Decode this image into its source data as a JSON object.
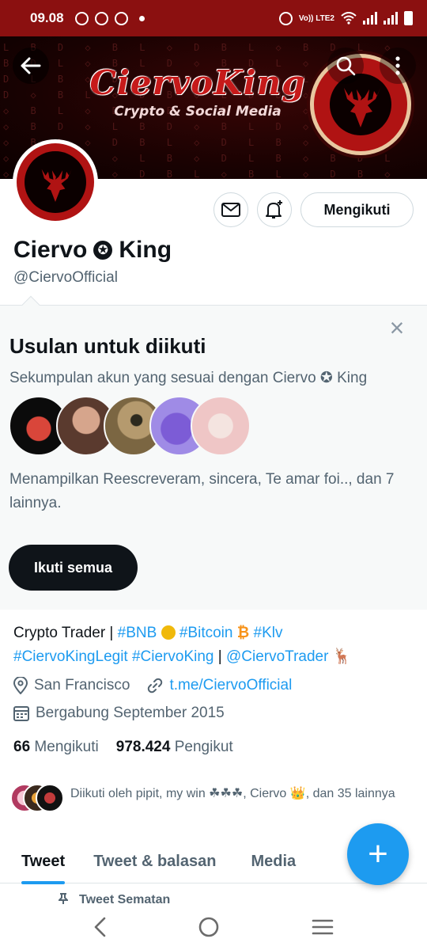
{
  "status_bar": {
    "time": "09.08",
    "net_label": "Vo)) LTE2"
  },
  "banner": {
    "title": "CiervoKing",
    "subtitle": "Crypto & Social Media",
    "pattern": "L B D ◇ B L ◇ D B L ◇ B D L ◇ B D L ◇ B L D ◇ B D L ◇ L B ◇ D L B ◇ D B L ◇ B D ◇ L B ◇ L D ◇ B L ◇ D B ◇ L D B ◇ L B D ◇ B L ◇ D L B ◇ D B L ◇ D B L ◇ B D ◇ L B D ◇ B L D ◇ B D L ◇ B L ◇ D B L ◇ D L B ◇ D B L ◇ B D L ◇ L B ◇ D L B ◇ B D L ◇ B L D ◇ D B L ◇ B L ◇ D B ◇ L D B ◇ L B ◇ D L B ◇ D B ◇ L D ◇ B L D ◇ B L ◇ D B ◇ L B D ◇ L"
  },
  "profile": {
    "name_first": "Ciervo",
    "name_last": "King",
    "handle": "@CiervoOfficial",
    "follow_button": "Mengikuti"
  },
  "suggestions": {
    "title": "Usulan untuk diikuti",
    "description": "Sekumpulan akun yang sesuai dengan Ciervo ✪ King",
    "shown_text": "Menampilkan Reescreveram, sincera, Te amar foi.., dan 7 lainnya.",
    "follow_all": "Ikuti semua",
    "close_glyph": "×"
  },
  "bio": {
    "text_start": "Crypto Trader | ",
    "tags": [
      "#BNB",
      "#Bitcoin",
      "#Klv",
      "#CiervoKingLegit",
      "#CiervoKing",
      "@CiervoTrader"
    ],
    "btc_glyph": "₿",
    "sep": " | ",
    "deer_glyph": "🦌"
  },
  "meta": {
    "location": "San Francisco",
    "link": "t.me/CiervoOfficial",
    "joined": "Bergabung September 2015"
  },
  "counts": {
    "following_num": "66",
    "following_label": "Mengikuti",
    "followers_num": "978.424",
    "followers_label": "Pengikut"
  },
  "followed_by": "Diikuti oleh pipit, my win ☘☘☘, Ciervo 👑, dan 35 lainnya",
  "tabs": [
    "Tweet",
    "Tweet & balasan",
    "Media"
  ],
  "fab_glyph": "+",
  "pinned_label": "Tweet Sematan",
  "colors": {
    "status_bar": "#8b1010",
    "accent": "#1d9bf0",
    "text": "#0f1419",
    "secondary": "#536471",
    "brand_red": "#b01313"
  },
  "icons": [
    "back-arrow-icon",
    "search-icon",
    "more-vertical-icon",
    "mail-icon",
    "bell-plus-icon",
    "verified-star-icon",
    "location-pin-icon",
    "link-icon",
    "calendar-icon",
    "pin-icon",
    "nav-back-icon",
    "nav-home-icon",
    "nav-recents-icon"
  ]
}
